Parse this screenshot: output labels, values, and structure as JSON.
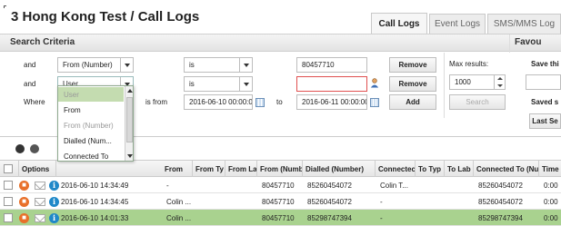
{
  "header": {
    "title": "3 Hong Kong Test / Call Logs",
    "tabs": [
      {
        "label": "Call Logs",
        "active": true
      },
      {
        "label": "Event Logs",
        "active": false
      },
      {
        "label": "SMS/MMS Log",
        "active": false
      }
    ]
  },
  "search": {
    "title": "Search Criteria",
    "favourites_label": "Favou",
    "rows": [
      {
        "conj": "and",
        "field": "From (Number)",
        "op": "is",
        "value": "80457710",
        "button": "Remove"
      },
      {
        "conj": "and",
        "field": "User",
        "op": "is",
        "value": "",
        "button": "Remove"
      },
      {
        "conj": "Where",
        "field": "",
        "between_label": "is from",
        "from": "2016-06-10 00:00:00",
        "to_label": "to",
        "to": "2016-06-11 00:00:00",
        "button": "Add"
      }
    ],
    "max_results_label": "Max results:",
    "max_results_value": "1000",
    "search_button": "Search",
    "save_label": "Save thi",
    "saved_label": "Saved s",
    "last_label": "Last Se"
  },
  "field_dropdown": {
    "options": [
      {
        "label": "User",
        "state": "selected"
      },
      {
        "label": "From",
        "state": "normal"
      },
      {
        "label": "From (Number)",
        "state": "muted"
      },
      {
        "label": "Dialled (Num...",
        "state": "normal"
      },
      {
        "label": "Connected To",
        "state": "normal"
      }
    ]
  },
  "table": {
    "columns": [
      "Options",
      "From",
      "From Ty",
      "From La",
      "From (Numb",
      "Dialled (Number)",
      "Connectec",
      "To Typ",
      "To Lab",
      "Connected To (Nu",
      "Time"
    ],
    "rows": [
      {
        "datetime": "2016-06-10 14:34:49",
        "user": "-",
        "from": "",
        "from_type": "",
        "from_label": "",
        "from_number": "80457710",
        "dialled": "85260454072",
        "connected": "Colin T...",
        "to_type": "",
        "to_label": "",
        "connected_to": "85260454072",
        "time": "0:00",
        "selected": false
      },
      {
        "datetime": "2016-06-10 14:34:45",
        "user": "Colin ...",
        "from": "",
        "from_type": "",
        "from_label": "",
        "from_number": "80457710",
        "dialled": "85260454072",
        "connected": "-",
        "to_type": "",
        "to_label": "",
        "connected_to": "85260454072",
        "time": "0:00",
        "selected": false
      },
      {
        "datetime": "2016-06-10 14:01:33",
        "user": "Colin ...",
        "from": "",
        "from_type": "",
        "from_label": "",
        "from_number": "80457710",
        "dialled": "85298747394",
        "connected": "-",
        "to_type": "",
        "to_label": "",
        "connected_to": "85298747394",
        "time": "0:00",
        "selected": true
      }
    ]
  },
  "colors": {
    "selected_row": "#a9d28f",
    "stop_icon": "#e8702a",
    "info_icon": "#1f88c8",
    "error_border": "#e05050"
  }
}
